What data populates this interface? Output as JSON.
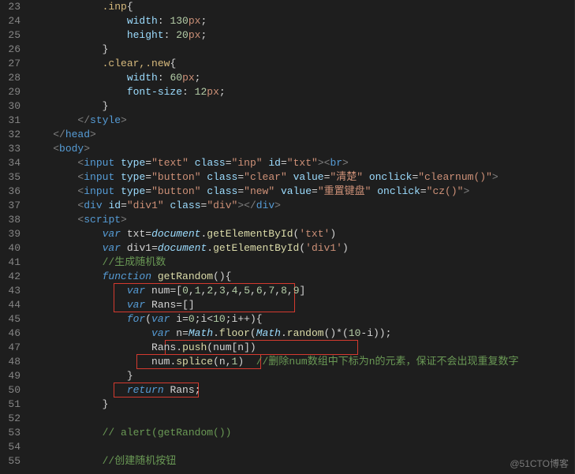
{
  "watermark": "@51CTO博客",
  "line_start": 23,
  "line_end": 55,
  "lines": {
    "l23": {
      "indent": "            ",
      "sel": ".inp",
      "tail": "{"
    },
    "l24": {
      "indent": "                ",
      "prop": "width",
      "val": "130",
      "unit": "px"
    },
    "l25": {
      "indent": "                ",
      "prop": "height",
      "val": "20",
      "unit": "px"
    },
    "l26": {
      "indent": "            ",
      "text": "}"
    },
    "l27": {
      "indent": "            ",
      "sel": ".clear,.new",
      "tail": "{"
    },
    "l28": {
      "indent": "                ",
      "prop": "width",
      "val": "60",
      "unit": "px"
    },
    "l29": {
      "indent": "                ",
      "prop": "font-size",
      "val": "12",
      "unit": "px"
    },
    "l30": {
      "indent": "            ",
      "text": "}"
    },
    "l31": {
      "indent": "        ",
      "close": "style"
    },
    "l32": {
      "indent": "    ",
      "close": "head"
    },
    "l33": {
      "indent": "    ",
      "open": "body"
    },
    "l34": {
      "indent": "        ",
      "tag": "input",
      "attrs": [
        [
          "type",
          "text"
        ],
        [
          "class",
          "inp"
        ],
        [
          "id",
          "txt"
        ]
      ],
      "tail_tag": "br"
    },
    "l35": {
      "indent": "        ",
      "tag": "input",
      "attrs": [
        [
          "type",
          "button"
        ],
        [
          "class",
          "clear"
        ],
        [
          "value",
          "清楚"
        ],
        [
          "onclick",
          "clearnum()"
        ]
      ]
    },
    "l36": {
      "indent": "        ",
      "tag": "input",
      "attrs": [
        [
          "type",
          "button"
        ],
        [
          "class",
          "new"
        ],
        [
          "value",
          "重置键盘"
        ],
        [
          "onclick",
          "cz()"
        ]
      ]
    },
    "l37": {
      "indent": "        ",
      "tag": "div",
      "attrs": [
        [
          "id",
          "div1"
        ],
        [
          "class",
          "div"
        ]
      ],
      "close_same": "div"
    },
    "l38": {
      "indent": "        ",
      "open": "script"
    },
    "l39": {
      "indent": "            ",
      "kw": "var",
      "name": "txt",
      "call": "document.getElementById",
      "arg": "'txt'"
    },
    "l40": {
      "indent": "            ",
      "kw": "var",
      "name": "div1",
      "call": "document.getElementById",
      "arg": "'div1'"
    },
    "l41": {
      "indent": "            ",
      "comment": "//生成随机数"
    },
    "l42": {
      "indent": "            ",
      "kw": "function",
      "fname": "getRandom"
    },
    "l43": {
      "indent": "                ",
      "kw": "var",
      "name": "num",
      "array": [
        0,
        1,
        2,
        3,
        4,
        5,
        6,
        7,
        8,
        9
      ]
    },
    "l44": {
      "indent": "                ",
      "kw": "var",
      "name": "Rans",
      "empty_array": true
    },
    "l45": {
      "indent": "                ",
      "for_i_lt": 10
    },
    "l46": {
      "indent": "                    ",
      "kw": "var",
      "name": "n",
      "math_floor_random_times": 10
    },
    "l47": {
      "indent": "                    ",
      "push_target": "Rans",
      "push_arg": "num[n]"
    },
    "l48": {
      "indent": "                    ",
      "splice_target": "num",
      "splice_args": [
        "n",
        "1"
      ],
      "comment": "//删除num数组中下标为n的元素，保证不会出现重复数字"
    },
    "l49": {
      "indent": "                ",
      "text": "}"
    },
    "l50": {
      "indent": "                ",
      "return": "Rans"
    },
    "l51": {
      "indent": "            ",
      "text": "}"
    },
    "l52": {
      "indent": "",
      "text": ""
    },
    "l53": {
      "indent": "            ",
      "comment": "// alert(getRandom())"
    },
    "l54": {
      "indent": "",
      "text": ""
    },
    "l55": {
      "indent": "            ",
      "comment": "//创建随机按钮"
    }
  },
  "boxes": [
    {
      "top_line": 43,
      "bottom_line": 44,
      "left_ch": 15,
      "right_ch": 47
    },
    {
      "top_line": 47,
      "bottom_line": 47,
      "left_ch": 24,
      "right_ch": 58
    },
    {
      "top_line": 48,
      "bottom_line": 48,
      "left_ch": 19,
      "right_ch": 41
    },
    {
      "top_line": 50,
      "bottom_line": 50,
      "left_ch": 15,
      "right_ch": 30
    }
  ]
}
